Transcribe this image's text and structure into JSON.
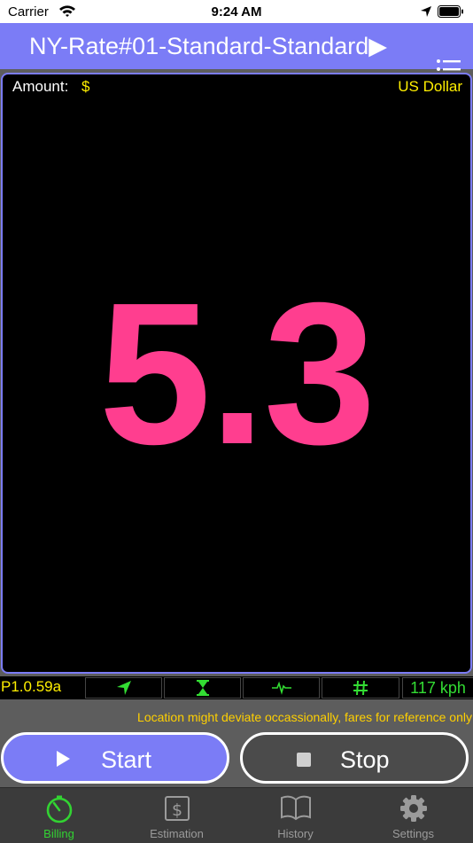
{
  "status_bar": {
    "carrier": "Carrier",
    "time": "9:24 AM",
    "icons": [
      "wifi-icon",
      "location-arrow-icon",
      "battery-icon"
    ]
  },
  "nav": {
    "title": "NY-Rate#01-Standard-Standard▶",
    "menu_icon": "list-icon"
  },
  "meter": {
    "amount_label": "Amount:",
    "currency_symbol": "$",
    "currency_name": "US Dollar",
    "fare": "5.3"
  },
  "info_bar": {
    "version": "P1.0.59a",
    "indicators": [
      "navigation-arrow-icon",
      "hourglass-icon",
      "pulse-icon",
      "hash-icon"
    ],
    "speed": "117 kph"
  },
  "notice": "Location might deviate occassionally, fares for reference only",
  "buttons": {
    "start_label": "Start",
    "stop_label": "Stop"
  },
  "tabs": [
    {
      "label": "Billing",
      "icon": "timer-icon",
      "active": true
    },
    {
      "label": "Estimation",
      "icon": "dollar-icon",
      "active": false
    },
    {
      "label": "History",
      "icon": "book-icon",
      "active": false
    },
    {
      "label": "Settings",
      "icon": "gear-icon",
      "active": false
    }
  ],
  "colors": {
    "accent": "#7b7cf6",
    "fare": "#ff3e8f",
    "yellow": "#ffef00",
    "green": "#33dd33"
  }
}
